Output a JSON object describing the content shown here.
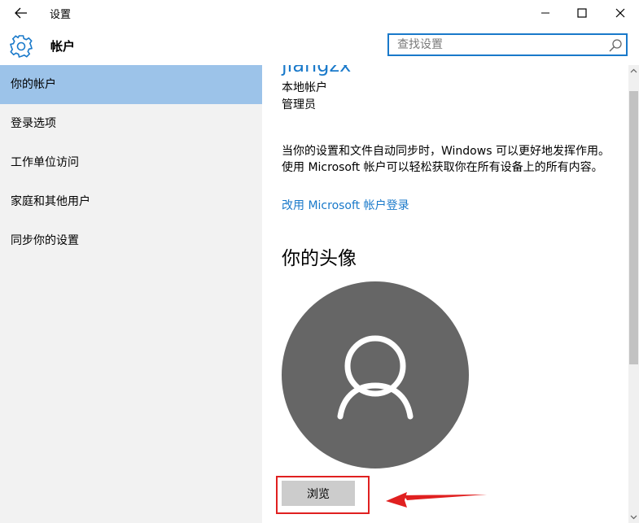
{
  "window": {
    "title": "设置",
    "back_icon": "back-arrow-icon",
    "controls": [
      "minimize-icon",
      "maximize-icon",
      "close-icon"
    ]
  },
  "header": {
    "icon": "gear-icon",
    "title": "帐户",
    "search": {
      "placeholder": "查找设置",
      "value": "",
      "icon": "search-icon"
    }
  },
  "sidebar": {
    "items": [
      {
        "label": "你的帐户",
        "selected": true
      },
      {
        "label": "登录选项",
        "selected": false
      },
      {
        "label": "工作单位访问",
        "selected": false
      },
      {
        "label": "家庭和其他用户",
        "selected": false
      },
      {
        "label": "同步你的设置",
        "selected": false
      }
    ]
  },
  "main": {
    "username": "jiangzx",
    "account_type": "本地帐户",
    "account_role": "管理员",
    "description": "当你的设置和文件自动同步时，Windows 可以更好地发挥作用。使用 Microsoft 帐户可以轻松获取你在所有设备上的所有内容。",
    "ms_link": "改用 Microsoft 帐户登录",
    "avatar_section_title": "你的头像",
    "avatar_icon": "person-icon",
    "browse_button": "浏览"
  },
  "colors": {
    "accent": "#1979ca",
    "sidebar_bg": "#f2f2f2",
    "selected_bg": "#9cc3e9",
    "avatar_bg": "#666666",
    "annotation": "#e02020"
  }
}
